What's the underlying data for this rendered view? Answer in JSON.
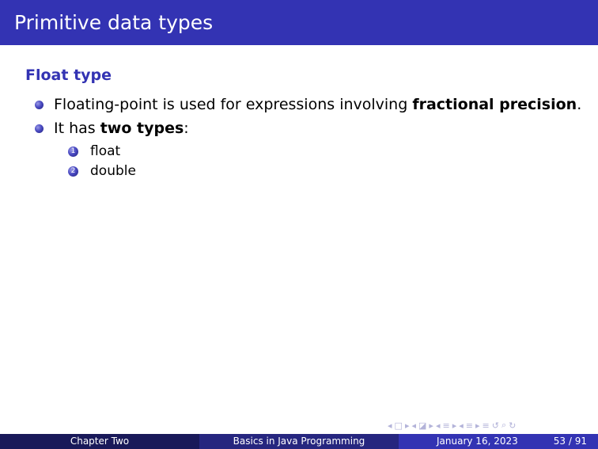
{
  "frame": {
    "title": "Primitive data types"
  },
  "block": {
    "title": "Float type"
  },
  "bullets": [
    {
      "before": "Floating-point is used for expressions involving ",
      "bold": "fractional precision",
      "after": "."
    },
    {
      "before": "It has ",
      "bold": "two types",
      "after": ":"
    }
  ],
  "enumeration": [
    {
      "number": "1",
      "text": "float"
    },
    {
      "number": "2",
      "text": "double"
    }
  ],
  "navigation": {
    "glyphs": [
      "◂",
      "□",
      "▸",
      "◂",
      "◪",
      "▸",
      "◂",
      "≡",
      "▸",
      "◂",
      "≡",
      "▸",
      "≡",
      "↺",
      "⌕",
      "↻"
    ]
  },
  "footer": {
    "section": "Chapter Two",
    "talk_title": "Basics in Java Programming",
    "date": "January 16, 2023",
    "page": "53 / 91"
  },
  "colors": {
    "accent": "#3333b3",
    "footer_dark": "#191959",
    "footer_mid": "#26267f"
  }
}
